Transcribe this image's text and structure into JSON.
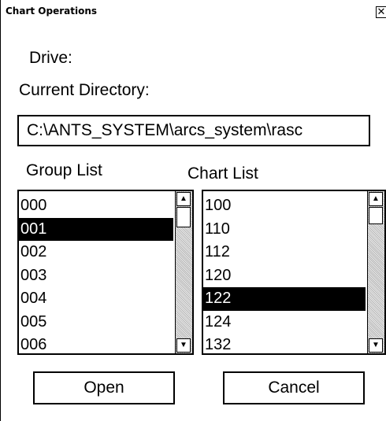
{
  "window": {
    "title": "Chart Operations",
    "close_glyph": "✕"
  },
  "drive": {
    "label": "Drive:"
  },
  "directory": {
    "label": "Current Directory:",
    "value": "C:\\ANTS_SYSTEM\\arcs_system\\rasc"
  },
  "group_list": {
    "label": "Group List",
    "items": [
      "000",
      "001",
      "002",
      "003",
      "004",
      "005",
      "006"
    ],
    "selected_index": 1
  },
  "chart_list": {
    "label": "Chart List",
    "items": [
      "100",
      "110",
      "112",
      "120",
      "122",
      "124",
      "132"
    ],
    "selected_index": 4
  },
  "scroll": {
    "up_glyph": "▲",
    "down_glyph": "▼"
  },
  "buttons": {
    "open_label": "Open",
    "cancel_label": "Cancel"
  }
}
